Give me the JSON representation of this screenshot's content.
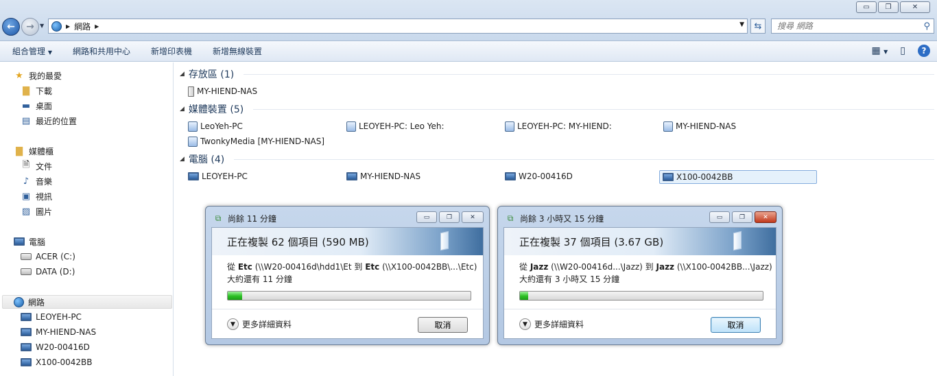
{
  "address": {
    "crumb": "網路",
    "search_placeholder": "搜尋 網路"
  },
  "window_controls": {
    "minimize": "▭",
    "maximize": "❐",
    "close": "✕"
  },
  "toolbar": {
    "organize": "組合管理",
    "network_center": "網路和共用中心",
    "add_printer": "新增印表機",
    "add_wireless": "新增無線裝置"
  },
  "sidebar": {
    "favorites": "我的最愛",
    "downloads": "下載",
    "desktop": "桌面",
    "recent": "最近的位置",
    "libraries": "媒體櫃",
    "documents": "文件",
    "music": "音樂",
    "videos": "視訊",
    "pictures": "圖片",
    "computer": "電腦",
    "drive_c": "ACER (C:)",
    "drive_d": "DATA (D:)",
    "network": "網路",
    "net_items": [
      "LEOYEH-PC",
      "MY-HIEND-NAS",
      "W20-00416D",
      "X100-0042BB"
    ]
  },
  "groups": {
    "storage": {
      "label": "存放區 (1)",
      "items": [
        "MY-HIEND-NAS"
      ]
    },
    "media": {
      "label": "媒體裝置 (5)",
      "items": [
        "LeoYeh-PC",
        "LEOYEH-PC: Leo Yeh:",
        "LEOYEH-PC: MY-HIEND:",
        "MY-HIEND-NAS",
        "TwonkyMedia [MY-HIEND-NAS]"
      ]
    },
    "computers": {
      "label": "電腦 (4)",
      "items": [
        "LEOYEH-PC",
        "MY-HIEND-NAS",
        "W20-00416D",
        "X100-0042BB"
      ]
    }
  },
  "dialog1": {
    "title": "尚餘 11 分鐘",
    "heading": "正在複製 62 個項目 (590 MB)",
    "from_prefix": "從 ",
    "src_name": "Etc",
    "src_path": " (\\\\W20-00416d\\hdd1\\Et",
    "to_word": " 到 ",
    "dst_name": "Etc",
    "dst_path": " (\\\\X100-0042BB\\...\\Etc)",
    "remaining": "大約還有 11 分鐘",
    "progress": 0.06,
    "more": "更多詳細資料",
    "cancel": "取消"
  },
  "dialog2": {
    "title": "尚餘 3 小時又 15 分鐘",
    "heading": "正在複製 37 個項目 (3.67 GB)",
    "from_prefix": "從 ",
    "src_name": "Jazz",
    "src_path": " (\\\\W20-00416d...\\Jazz)",
    "to_word": " 到 ",
    "dst_name": "Jazz",
    "dst_path": " (\\\\X100-0042BB...\\Jazz)",
    "remaining": "大約還有 3 小時又 15 分鐘",
    "progress": 0.035,
    "more": "更多詳細資料",
    "cancel": "取消"
  }
}
